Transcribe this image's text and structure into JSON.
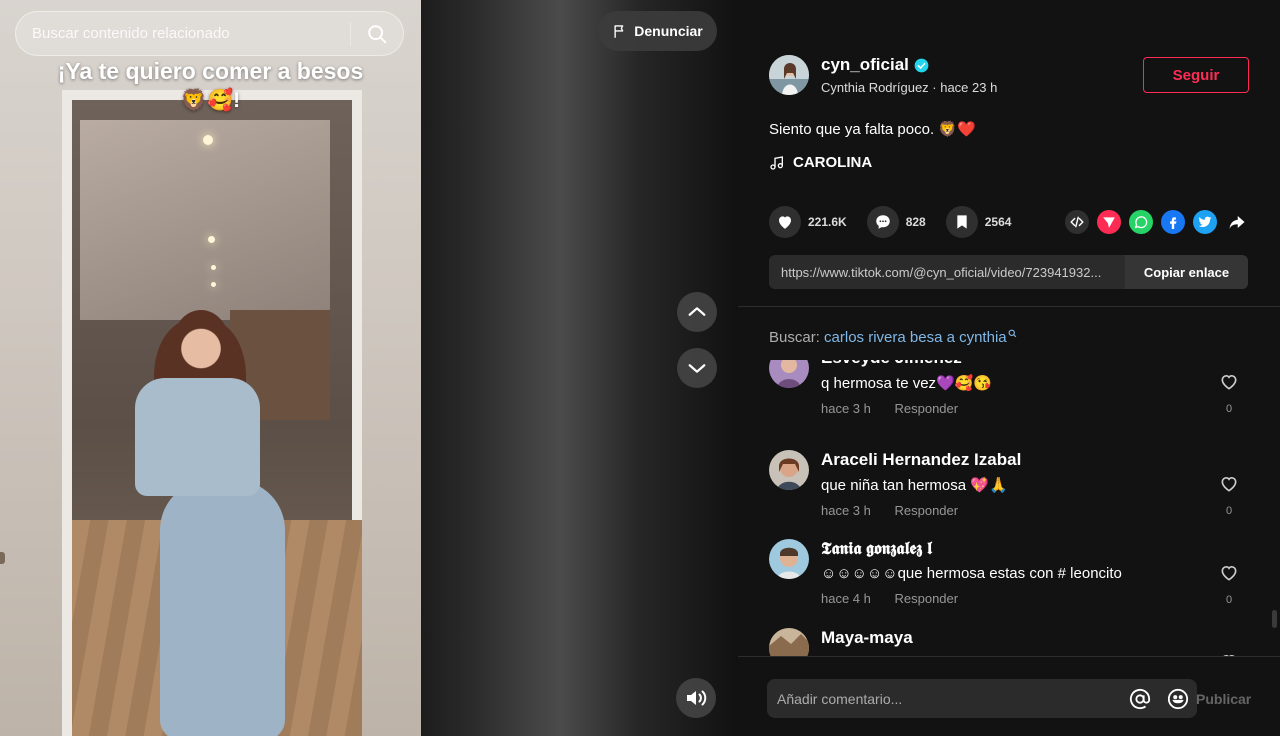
{
  "search": {
    "placeholder": "Buscar contenido relacionado"
  },
  "video": {
    "caption_line1": "¡Ya te quiero comer a besos",
    "caption_line2": "🦁🥰!"
  },
  "report": {
    "label": "Denunciar"
  },
  "author": {
    "username": "cyn_oficial",
    "subline": "Cynthia Rodríguez · hace 23 h",
    "verified": true
  },
  "follow": {
    "label": "Seguir"
  },
  "post": {
    "description": "Siento que ya falta poco. 🦁❤️",
    "music": "CAROLINA"
  },
  "stats": {
    "likes": "221.6K",
    "comments": "828",
    "saves": "2564"
  },
  "share_icons": [
    "embed-icon",
    "direct-send-icon",
    "whatsapp-icon",
    "facebook-icon",
    "twitter-icon",
    "share-arrow-icon"
  ],
  "link": {
    "url": "https://www.tiktok.com/@cyn_oficial/video/723941932...",
    "copy_label": "Copiar enlace"
  },
  "related": {
    "label": "Buscar:",
    "query": "carlos rivera besa a cynthia"
  },
  "comments": [
    {
      "name": "Esveyde Jimenez",
      "text": "q hermosa te vez💜🥰😘",
      "time": "hace 3 h",
      "reply": "Responder",
      "likes": "0"
    },
    {
      "name": "Araceli Hernandez Izabal",
      "text": "que niña tan hermosa 💖🙏",
      "time": "hace 3 h",
      "reply": "Responder",
      "likes": "0"
    },
    {
      "name": "𝕿𝖆𝖓𝖎𝖆 𝖌𝖔𝖓𝖟𝖆𝖑𝖊𝖟 𝖑",
      "text": "☺☺☺☺☺que hermosa estas con # leoncito",
      "time": "hace 4 h",
      "reply": "Responder",
      "likes": "0"
    },
    {
      "name": "Maya-maya",
      "text": "",
      "time": "",
      "reply": "",
      "likes": ""
    }
  ],
  "composer": {
    "placeholder": "Añadir comentario...",
    "publish_label": "Publicar"
  },
  "colors": {
    "accent": "#fe2c55",
    "link": "#80b8e8",
    "panel_bg": "#121212",
    "verified": "#20d5ec"
  }
}
